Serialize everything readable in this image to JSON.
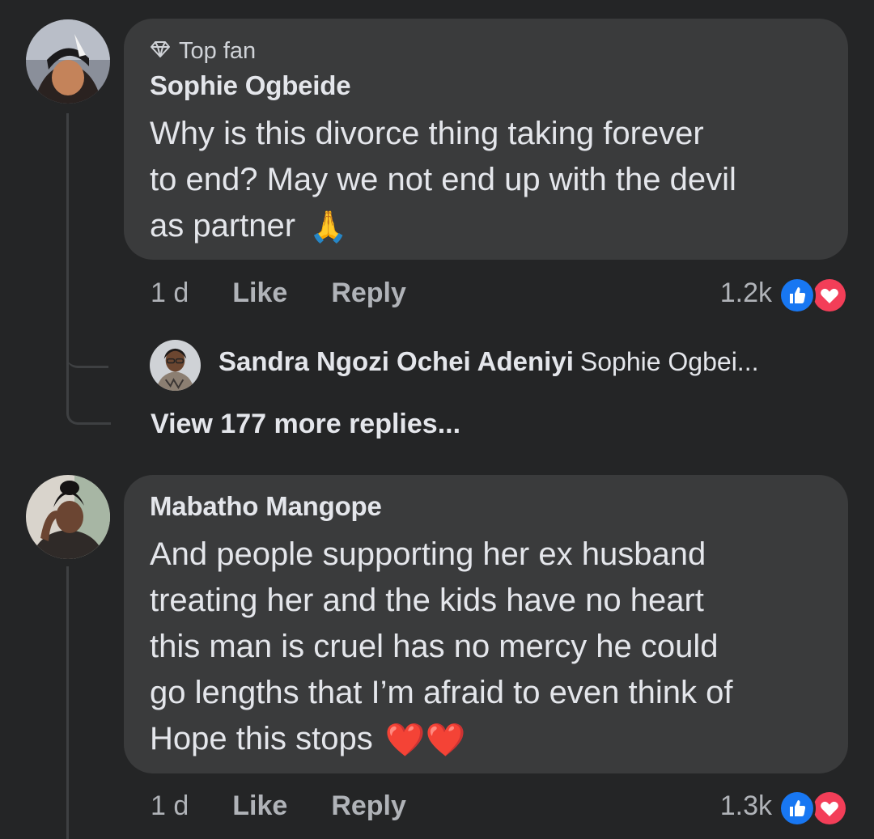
{
  "comments": [
    {
      "badge": "Top fan",
      "author": "Sophie Ogbeide",
      "lines": [
        "Why is this divorce thing taking forever",
        "to end? May we not end up with the devil",
        "as partner"
      ],
      "emoji": "🙏",
      "time": "1 d",
      "like_label": "Like",
      "reply_label": "Reply",
      "reaction_count": "1.2k",
      "reply_preview": {
        "author": "Sandra Ngozi Ochei Adeniyi",
        "text": "Sophie Ogbei..."
      },
      "view_more": "View 177 more replies..."
    },
    {
      "author": "Mabatho Mangope",
      "lines": [
        "And people supporting her ex husband",
        "treating her and the kids have no heart",
        "this man is cruel has no mercy he could",
        "go lengths that I’m afraid to even think of",
        "Hope this stops"
      ],
      "emoji": "❤️❤️",
      "time": "1 d",
      "like_label": "Like",
      "reply_label": "Reply",
      "reaction_count": "1.3k"
    }
  ],
  "icons": {
    "badge": "diamond-icon",
    "like_reaction": "thumbs-up-icon",
    "love_reaction": "heart-icon"
  },
  "colors": {
    "background": "#242526",
    "bubble": "#3a3b3c",
    "like_blue": "#1877f2",
    "love_red": "#f33e58"
  }
}
